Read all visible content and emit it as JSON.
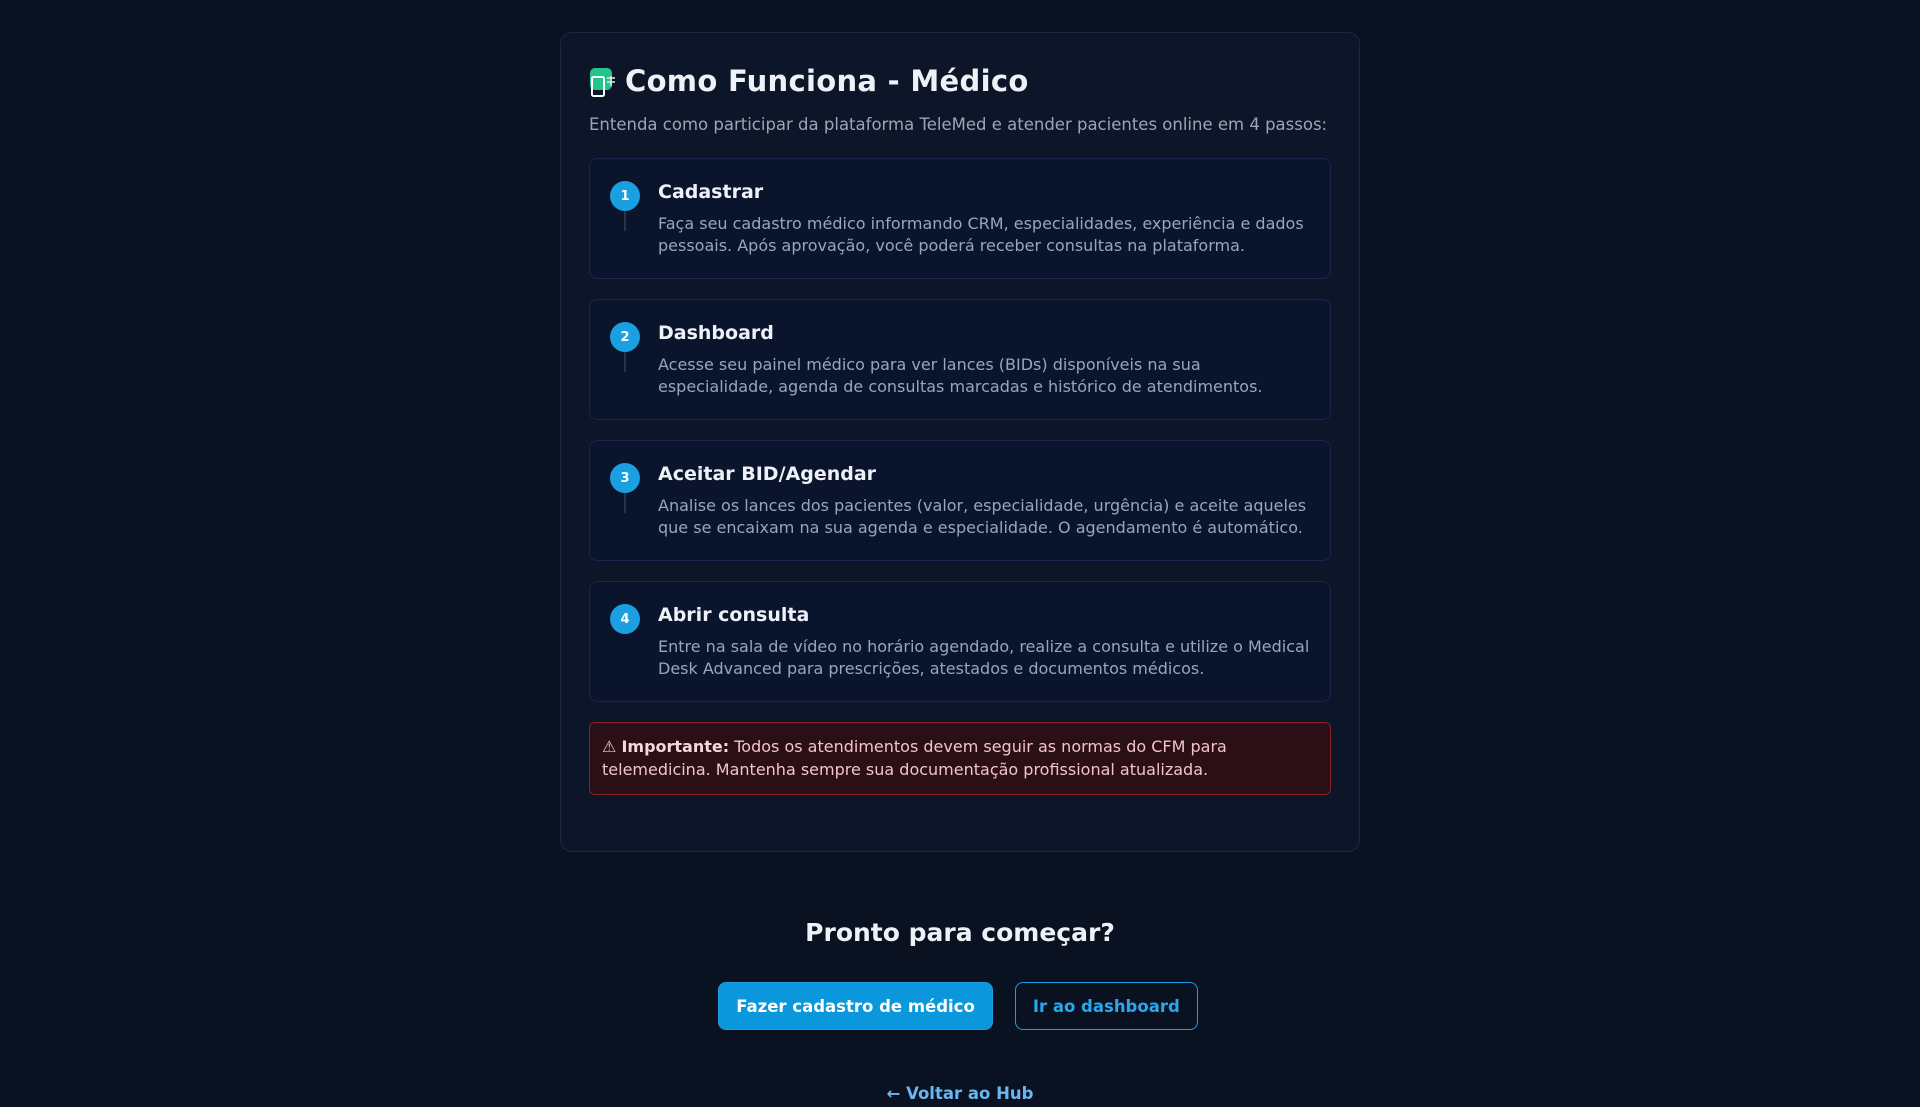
{
  "card": {
    "title_icon": "doctor-phone-icon",
    "title": "Como Funciona - Médico",
    "subtitle": "Entenda como participar da plataforma TeleMed e atender pacientes online em 4 passos:",
    "steps": [
      {
        "number": "1",
        "title": "Cadastrar",
        "description": "Faça seu cadastro médico informando CRM, especialidades, experiência e dados pessoais. Após aprovação, você poderá receber consultas na plataforma."
      },
      {
        "number": "2",
        "title": "Dashboard",
        "description": "Acesse seu painel médico para ver lances (BIDs) disponíveis na sua especialidade, agenda de consultas marcadas e histórico de atendimentos."
      },
      {
        "number": "3",
        "title": "Aceitar BID/Agendar",
        "description": "Analise os lances dos pacientes (valor, especialidade, urgência) e aceite aqueles que se encaixam na sua agenda e especialidade. O agendamento é automático."
      },
      {
        "number": "4",
        "title": "Abrir consulta",
        "description": "Entre na sala de vídeo no horário agendado, realize a consulta e utilize o Medical Desk Advanced para prescrições, atestados e documentos médicos."
      }
    ],
    "warning": {
      "icon": "⚠",
      "label": "Importante:",
      "text": "Todos os atendimentos devem seguir as normas do CFM para telemedicina. Mantenha sempre sua documentação profissional atualizada."
    }
  },
  "cta": {
    "title": "Pronto para começar?",
    "primary_label": "Fazer cadastro de médico",
    "secondary_label": "Ir ao dashboard"
  },
  "back_link": "← Voltar ao Hub",
  "colors": {
    "background": "#0a1120",
    "accent": "#0a97dc",
    "warning_bg": "#2a0f17",
    "warning_border": "#8a1f2e"
  }
}
